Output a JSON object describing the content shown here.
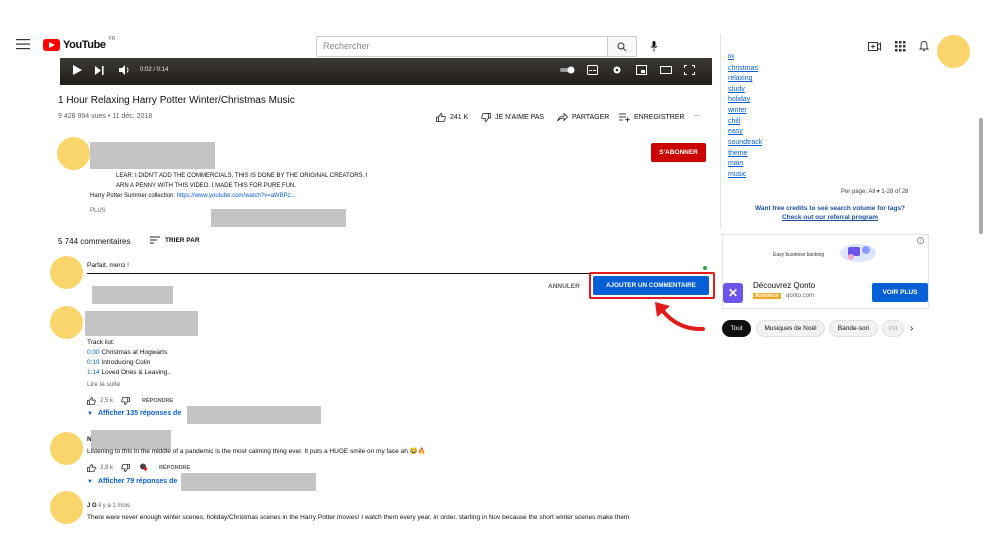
{
  "masthead": {
    "logo_text": "YouTube",
    "logo_country": "FR",
    "search_placeholder": "Rechercher"
  },
  "player": {
    "time": "0:02 / 0:14"
  },
  "video": {
    "title": "1 Hour Relaxing Harry Potter Winter/Christmas Music",
    "views_date": "9 428 994 vues • 11 déc. 2018",
    "likes": "241 K",
    "dislike_label": "JE N'AIME PAS",
    "share_label": "PARTAGER",
    "save_label": "ENREGISTRER",
    "more_label": "..."
  },
  "description": {
    "line1": "LEAR: I DIDN'T ADD THE COMMERCIALS, THIS IS DONE BY THE ORIGINAL CREATORS. I",
    "line2": "ARN A PENNY WITH THIS VIDEO. I MADE THIS FOR PURE FUN.",
    "line3_text": "Harry Potter Summer collection: ",
    "line3_link": "https://www.youtube.com/watch?v=aWBPz...",
    "more": "PLUS",
    "subscribe": "S'ABONNER"
  },
  "comments_header": {
    "count": "5 744 commentaires",
    "sort_label": "TRIER PAR"
  },
  "comment_input": {
    "text": "Parfait, merci !",
    "cancel": "ANNULER",
    "submit": "AJOUTER UN COMMENTAIRE"
  },
  "comment1": {
    "line0": "Track list:",
    "tracks": [
      {
        "time": "0:00",
        "title": "Christmas at Hogwarts"
      },
      {
        "time": "0:19",
        "title": "Introducing Colin"
      },
      {
        "time": "1:14",
        "title": "Loved Ones & Leaving.."
      }
    ],
    "read_more": "Lire la suite",
    "likes": "2,5 k",
    "reply": "RÉPONDRE",
    "replies": "Afficher 135 réponses de"
  },
  "comment2": {
    "author_initial": "N",
    "text": "Listening to this in the middle of a pandemic is the most calming thing ever. It puts a HUGE smile on my face ah 😂🔥",
    "likes": "3,9 k",
    "reply": "RÉPONDRE",
    "replies": "Afficher 79 réponses de"
  },
  "comment3": {
    "author": "J G",
    "time": "il y a 1 mois",
    "text": "There were never enough winter scenes, holiday/Christmas scenes in the Harry Potter movies!  I watch them every year, in order, starting in Nov because the short winter scenes make them"
  },
  "sidebar": {
    "tags": [
      "christmas",
      "relaxing",
      "study",
      "holiday",
      "winter",
      "chill",
      "easy",
      "soundtrack",
      "theme",
      "main",
      "music"
    ],
    "tag_partial": "hk",
    "per_page": "Per page:  All ▾  1-28 of 28",
    "credits_line1": "Want free credits to see search volume for tags?",
    "credits_line2": "Check out our referral program",
    "banner_text": "Easy business banking",
    "ad_title": "Découvrez Qonto",
    "ad_badge": "Annonce",
    "ad_url": "qonto.com",
    "ad_button": "VOIR PLUS",
    "chips": [
      "Tout",
      "Musiques de Noël",
      "Bande-son",
      "Vid"
    ]
  }
}
